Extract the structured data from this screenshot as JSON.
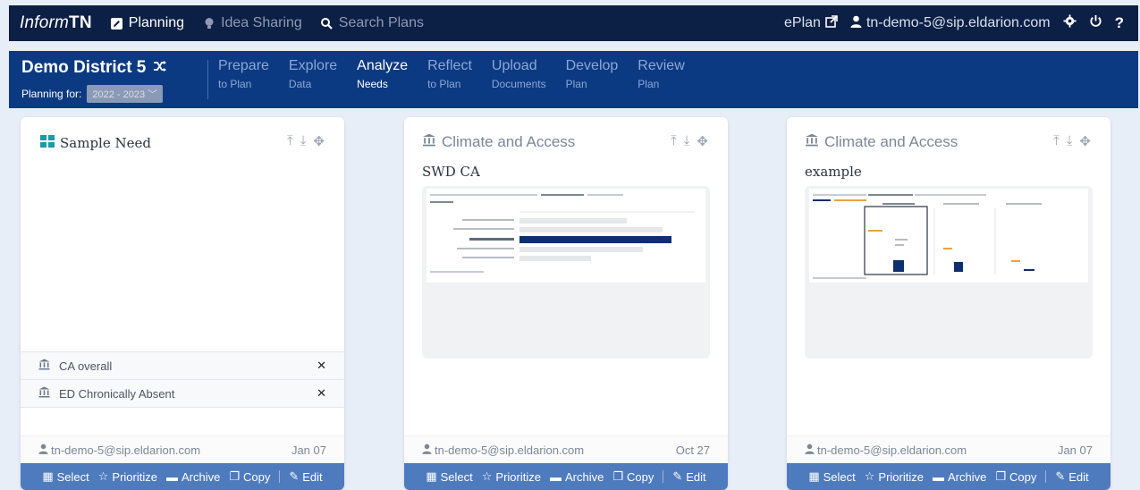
{
  "brand": {
    "part1": "Inform",
    "part2": "TN"
  },
  "topnav": [
    {
      "label": "Planning",
      "icon": "edit-square-icon"
    },
    {
      "label": "Idea Sharing",
      "icon": "lightbulb-icon"
    },
    {
      "label": "Search Plans",
      "icon": "search-icon"
    }
  ],
  "topright": {
    "eplan": "ePlan",
    "user": "tn-demo-5@sip.eldarion.com"
  },
  "district": {
    "name": "Demo District 5",
    "planning_label": "Planning for:",
    "year": "2022 - 2023"
  },
  "steps": [
    {
      "t1": "Prepare",
      "t2": "to Plan"
    },
    {
      "t1": "Explore",
      "t2": "Data"
    },
    {
      "t1": "Analyze",
      "t2": "Needs"
    },
    {
      "t1": "Reflect",
      "t2": "to Plan"
    },
    {
      "t1": "Upload",
      "t2": "Documents"
    },
    {
      "t1": "Develop",
      "t2": "Plan"
    },
    {
      "t1": "Review",
      "t2": "Plan"
    }
  ],
  "cards": [
    {
      "title": "Sample Need",
      "items": [
        "CA overall",
        "ED Chronically Absent"
      ],
      "author": "tn-demo-5@sip.eldarion.com",
      "date": "Jan 07"
    },
    {
      "title": "Climate and Access",
      "subtitle": "SWD CA",
      "author": "tn-demo-5@sip.eldarion.com",
      "date": "Oct 27"
    },
    {
      "title": "Climate and Access",
      "subtitle": "example",
      "author": "tn-demo-5@sip.eldarion.com",
      "date": "Jan 07"
    }
  ],
  "actions": {
    "select": "Select",
    "prioritize": "Prioritize",
    "archive": "Archive",
    "copy": "Copy",
    "edit": "Edit"
  },
  "colors": {
    "navy": "#0c1f45",
    "blue": "#0c3a82",
    "action_bar": "#4e7bbd",
    "teal": "#1b9aa8"
  }
}
